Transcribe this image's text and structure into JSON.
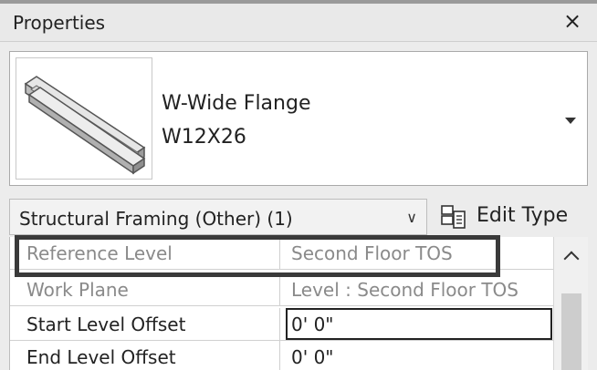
{
  "window": {
    "title": "Properties",
    "close_glyph": "×"
  },
  "type_selector": {
    "family": "W-Wide Flange",
    "type_name": "W12X26",
    "preview_icon": "steel-beam-icon",
    "dropdown_icon": "dropdown-arrow-icon"
  },
  "filter": {
    "label": "Structural Framing (Other) (1)",
    "chevron": "∨",
    "edit_type_label": "Edit Type",
    "edit_type_icon": "edit-type-icon"
  },
  "parameters": [
    {
      "name": "Reference Level",
      "value": "Second Floor TOS",
      "state": "disabled"
    },
    {
      "name": "Work Plane",
      "value": "Level : Second Floor TOS",
      "state": "disabled"
    },
    {
      "name": "Start Level Offset",
      "value": "0'  0\"",
      "state": "active"
    },
    {
      "name": "End Level Offset",
      "value": "0'  0\"",
      "state": "normal"
    }
  ],
  "colors": {
    "panel_bg": "#ececec",
    "highlight_border": "#3a3a3a",
    "disabled_text": "#8a8a8a"
  }
}
